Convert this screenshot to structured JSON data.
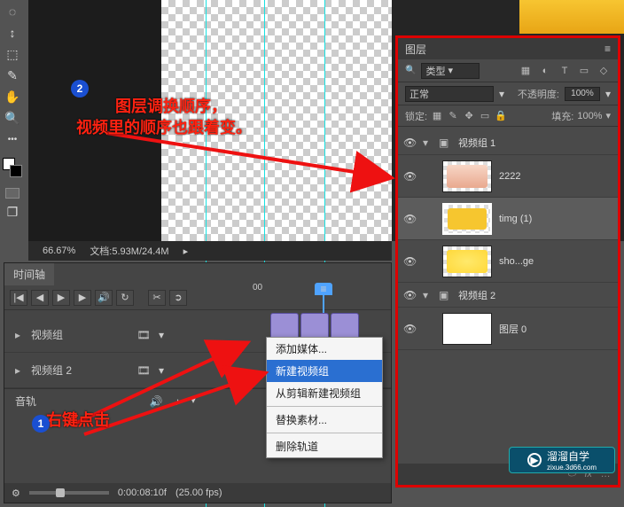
{
  "status": {
    "zoom": "66.67%",
    "doc": "文档:5.93M/24.4M"
  },
  "timeline": {
    "tab": "时间轴",
    "ruler_start": "00",
    "tracks": [
      "视频组",
      "视频组 2",
      "音轨"
    ],
    "bottom": {
      "time": "0:00:08:10f",
      "fps": "(25.00 fps)"
    }
  },
  "context_menu": {
    "items": [
      "添加媒体...",
      "新建视频组",
      "从剪辑新建视频组",
      "替换素材...",
      "删除轨道"
    ],
    "selected_index": 1
  },
  "layers": {
    "title": "图层",
    "filter_label": "类型",
    "blend_mode": "正常",
    "opacity_label": "不透明度:",
    "opacity_value": "100%",
    "lock_label": "锁定:",
    "fill_label": "填充:",
    "fill_value": "100%",
    "groups": [
      {
        "name": "视频组 1",
        "items": [
          {
            "name": "2222"
          },
          {
            "name": "timg (1)",
            "selected": true
          },
          {
            "name": "sho...ge"
          }
        ]
      },
      {
        "name": "视频组 2",
        "items": [
          {
            "name": "图层 0"
          }
        ]
      }
    ],
    "footer": "fx"
  },
  "annotations": {
    "line1": "图层调换顺序，",
    "line2": "视频里的顺序也跟着变。",
    "right_click": "右键点击"
  },
  "watermark": {
    "brand": "溜溜自学",
    "url": "zixue.3d66.com"
  },
  "icons": {
    "search": "🔍",
    "move": "↕",
    "lasso": "◌",
    "crop": "⬚",
    "eyedrop": "✎",
    "hand": "✋",
    "zoom": "🔍",
    "frame": "▭",
    "clone": "❐",
    "first": "|◀",
    "prev": "◀",
    "play": "▶",
    "next": "▶",
    "last": "▶|",
    "sound": "🔊",
    "loop": "↻",
    "cut": "✂",
    "split": "➲",
    "gear": "⚙",
    "eye": "👁",
    "chev_down": "▾",
    "chev_right": "▸",
    "film": "🎞",
    "folder": "▣",
    "link": "⬭",
    "note": "♪",
    "menu": "≡",
    "img": "▦",
    "adj": "◐",
    "text": "T",
    "sq": "▭",
    "pt": "◇"
  }
}
